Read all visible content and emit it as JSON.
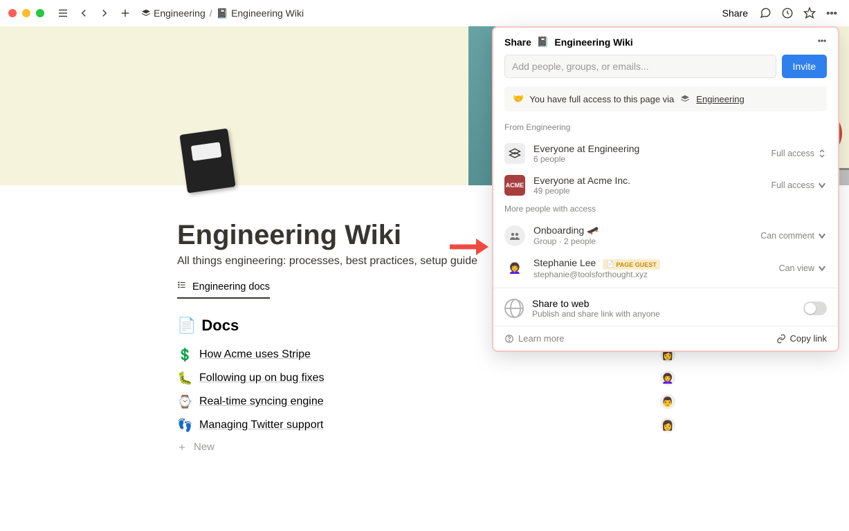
{
  "topbar": {
    "breadcrumb": [
      {
        "icon": "stack",
        "label": "Engineering"
      },
      {
        "icon": "notebook",
        "label": "Engineering Wiki"
      }
    ],
    "share_label": "Share"
  },
  "page": {
    "title": "Engineering Wiki",
    "description": "All things engineering: processes, best practices, setup guide",
    "db_tab_label": "Engineering docs",
    "docs_heading": "Docs",
    "docs": [
      {
        "emoji": "💲",
        "title": "How Acme uses Stripe"
      },
      {
        "emoji": "🐛",
        "title": "Following up on bug fixes"
      },
      {
        "emoji": "⌚",
        "title": "Real-time syncing engine"
      },
      {
        "emoji": "👣",
        "title": "Managing Twitter support"
      }
    ],
    "new_label": "New"
  },
  "share_panel": {
    "header_prefix": "Share",
    "header_page": "Engineering Wiki",
    "input_placeholder": "Add people, groups, or emails...",
    "invite_label": "Invite",
    "info_text_prefix": "You have full access to this page via",
    "info_link": "Engineering",
    "section1_label": "From Engineering",
    "members_from": [
      {
        "name": "Everyone at Engineering",
        "sub": "6 people",
        "perm": "Full access",
        "chevron": "updown"
      },
      {
        "name": "Everyone at Acme Inc.",
        "sub": "49 people",
        "perm": "Full access",
        "chevron": "down"
      }
    ],
    "section2_label": "More people with access",
    "members_more": [
      {
        "name": "Onboarding 🛹",
        "sub": "Group · 2 people",
        "perm": "Can comment",
        "badge": null
      },
      {
        "name": "Stephanie Lee",
        "sub": "stephanie@toolsforthought.xyz",
        "perm": "Can view",
        "badge": "PAGE GUEST"
      }
    ],
    "web": {
      "title": "Share to web",
      "sub": "Publish and share link with anyone"
    },
    "learn_more": "Learn more",
    "copy_link": "Copy link"
  }
}
